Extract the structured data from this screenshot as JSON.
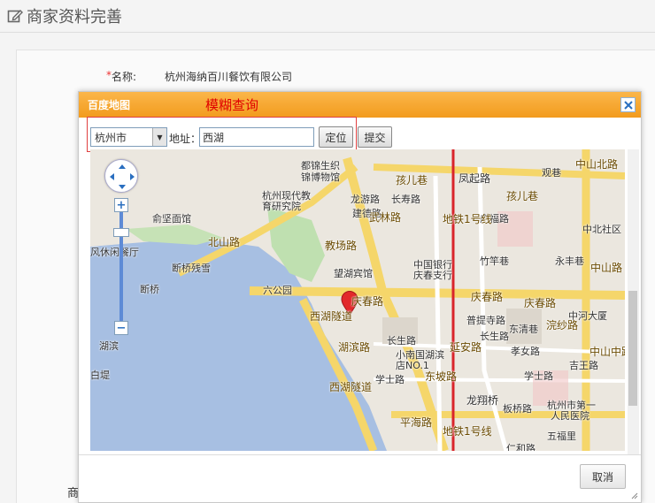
{
  "page": {
    "title": "商家资料完善",
    "title_icon": "edit-icon"
  },
  "form": {
    "required_mark": "*",
    "name_label": "名称:",
    "name_value": "杭州海纳百川餐饮有限公司",
    "partial_label": "商"
  },
  "dialog": {
    "title": "百度地图",
    "note": "模糊查询",
    "close_icon": "close-icon",
    "city": "杭州市",
    "address_label": "地址：",
    "address_value": "西湖",
    "locate_label": "定位",
    "submit_label": "提交",
    "cancel_label": "取消"
  },
  "map": {
    "labels": [
      "都锦生织",
      "锦博物馆",
      "孩儿巷",
      "凤起路",
      "观巷",
      "中山北路",
      "杭州现代教",
      "育研究院",
      "龙游路",
      "长寿路",
      "孩儿巷",
      "俞坚面馆",
      "建德路",
      "武林路",
      "广福路",
      "中北社区",
      "风休闲餐厅",
      "北山路",
      "教场路",
      "断桥残雪",
      "望湖宾馆",
      "中国银行",
      "庆春支行",
      "竹竿巷",
      "永丰巷",
      "中山路",
      "六公园",
      "庆春路",
      "庆春路",
      "庆春路",
      "中河大厦",
      "西湖隧道",
      "湖滨路",
      "普提寺路",
      "长生路",
      "东清巷",
      "孝女路",
      "长生路",
      "小南国湖滨",
      "店NO.1",
      "学士路",
      "东坡路",
      "学士路",
      "延安路",
      "西湖隧道",
      "龙翔桥",
      "板桥路",
      "杭州市第一",
      "人民医院",
      "中山中路",
      "平海路",
      "五福里",
      "仁和路",
      "地铁1号线",
      "地铁1号线",
      "白堤",
      "湖滨",
      "断桥",
      "浣纱路",
      "吉王路"
    ]
  }
}
